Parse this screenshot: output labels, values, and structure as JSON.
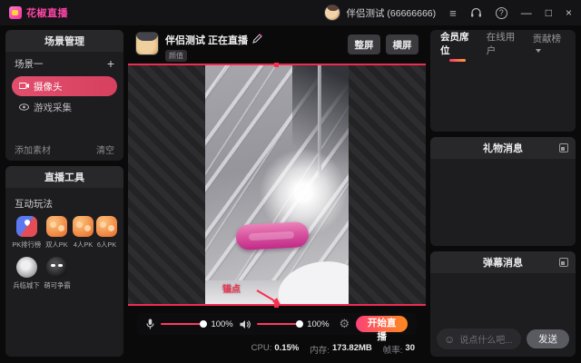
{
  "titlebar": {
    "app_name": "花椒直播",
    "account": "伴侣测试 (66666666)",
    "icons": {
      "menu": "≡",
      "help": "?",
      "minimize": "—",
      "maximize": "□",
      "close": "×"
    }
  },
  "scene_panel": {
    "title": "场景管理",
    "scene_name": "场景一",
    "add_scene": "+",
    "sources": [
      {
        "label": "摄像头",
        "selected": true
      },
      {
        "label": "游戏采集",
        "selected": false
      }
    ],
    "add_material": "添加素材",
    "clear": "清空"
  },
  "tools_panel": {
    "title": "直播工具",
    "section": "互动玩法",
    "tools": [
      {
        "label": "PK排行榜"
      },
      {
        "label": "双人PK"
      },
      {
        "label": "4人PK"
      },
      {
        "label": "6人PK"
      },
      {
        "label": "兵临城下"
      },
      {
        "label": "萌可争霸"
      }
    ]
  },
  "stream": {
    "title": "伴侣测试 正在直播",
    "category_badge": "颜值",
    "fullscreen_button": "整屏",
    "landscape_button": "横屏",
    "anchor_label": "锚点",
    "mic_volume": "100%",
    "speaker_volume": "100%",
    "start_button": "开始直播",
    "stats": {
      "cpu_label": "CPU:",
      "cpu": "0.15%",
      "mem_label": "内存:",
      "mem": "173.82MB",
      "fps_label": "帧率:",
      "fps": "30"
    }
  },
  "right_panel": {
    "tabs": [
      {
        "label": "会员席位",
        "active": true
      },
      {
        "label": "在线用户",
        "active": false
      },
      {
        "label": "贡献榜",
        "active": false
      }
    ],
    "gift_title": "礼物消息",
    "danmaku_title": "弹幕消息",
    "chat_placeholder": "说点什么吧...",
    "send": "发送"
  },
  "colors": {
    "accent_pink": "#ff3860",
    "accent_orange": "#ff8a1e",
    "selection_red": "#ef2b52",
    "source_selected": "#dd4a68"
  }
}
